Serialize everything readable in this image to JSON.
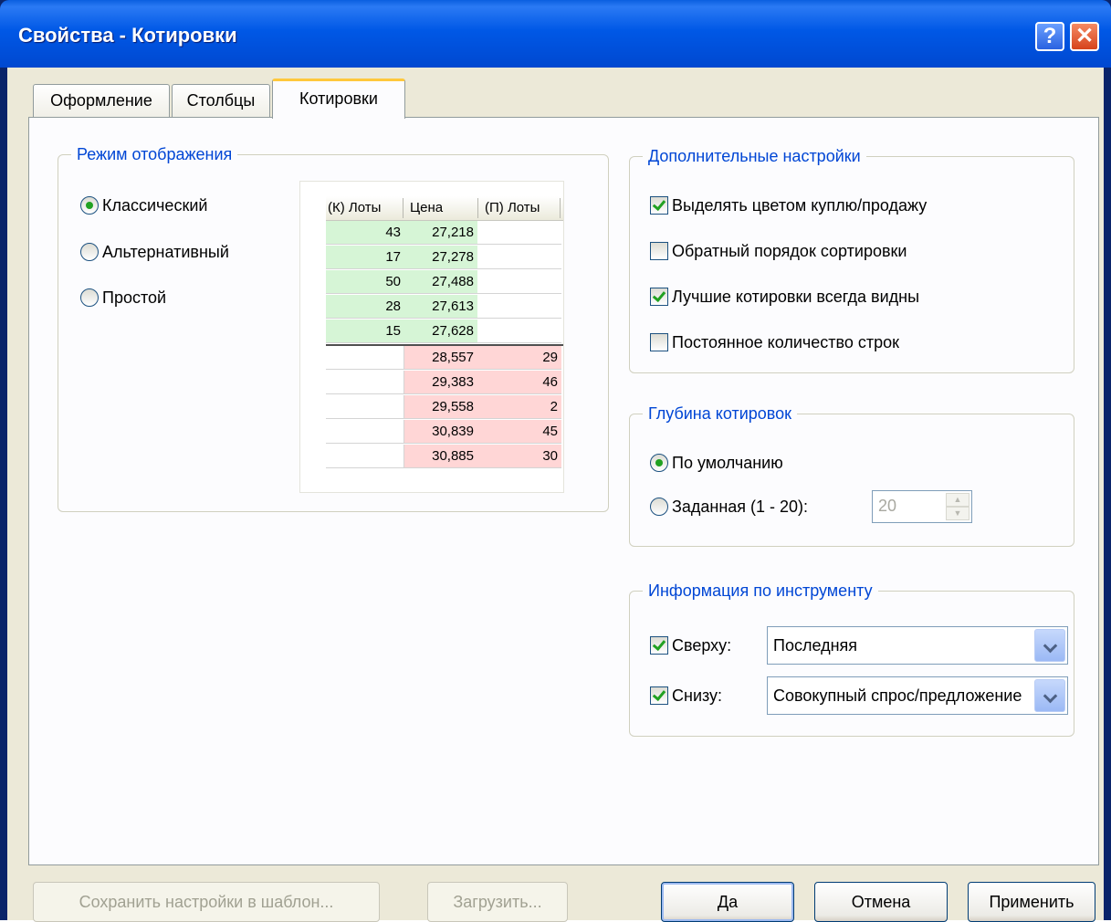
{
  "window": {
    "title": "Свойства - Котировки",
    "help_glyph": "?",
    "close_glyph": "✕"
  },
  "tabs": [
    {
      "label": "Оформление"
    },
    {
      "label": "Столбцы"
    },
    {
      "label": "Котировки"
    }
  ],
  "display_mode": {
    "legend": "Режим отображения",
    "options": [
      {
        "label": "Классический",
        "selected": true
      },
      {
        "label": "Альтернативный",
        "selected": false
      },
      {
        "label": "Простой",
        "selected": false
      }
    ],
    "preview": {
      "headers": [
        "(К) Лоты",
        "Цена",
        "(П) Лоты"
      ],
      "buy_rows": [
        {
          "lots": "43",
          "price": "27,218"
        },
        {
          "lots": "17",
          "price": "27,278"
        },
        {
          "lots": "50",
          "price": "27,488"
        },
        {
          "lots": "28",
          "price": "27,613"
        },
        {
          "lots": "15",
          "price": "27,628"
        }
      ],
      "sell_rows": [
        {
          "price": "28,557",
          "lots": "29"
        },
        {
          "price": "29,383",
          "lots": "46"
        },
        {
          "price": "29,558",
          "lots": "2"
        },
        {
          "price": "30,839",
          "lots": "45"
        },
        {
          "price": "30,885",
          "lots": "30"
        }
      ],
      "buy_color": "#d6f5d6",
      "sell_color": "#ffd6d6"
    }
  },
  "additional": {
    "legend": "Дополнительные настройки",
    "options": [
      {
        "label": "Выделять цветом куплю/продажу",
        "checked": true
      },
      {
        "label": "Обратный порядок сортировки",
        "checked": false
      },
      {
        "label": "Лучшие котировки всегда видны",
        "checked": true
      },
      {
        "label": "Постоянное количество строк",
        "checked": false
      }
    ]
  },
  "depth": {
    "legend": "Глубина котировок",
    "default_label": "По умолчанию",
    "default_selected": true,
    "custom_label": "Заданная (1 - 20):",
    "custom_selected": false,
    "custom_value": "20"
  },
  "instrument_info": {
    "legend": "Информация по инструменту",
    "top": {
      "label": "Сверху:",
      "checked": true,
      "value": "Последняя"
    },
    "bottom": {
      "label": "Снизу:",
      "checked": true,
      "value": "Совокупный спрос/предложение"
    }
  },
  "buttons": {
    "save_template": "Сохранить настройки в шаблон...",
    "load": "Загрузить...",
    "ok": "Да",
    "cancel": "Отмена",
    "apply": "Применить"
  },
  "colors": {
    "accent": "#0046d5",
    "titlebar": "#0058e6",
    "tab_highlight": "#ffc83c",
    "check_mark": "#21a121"
  }
}
